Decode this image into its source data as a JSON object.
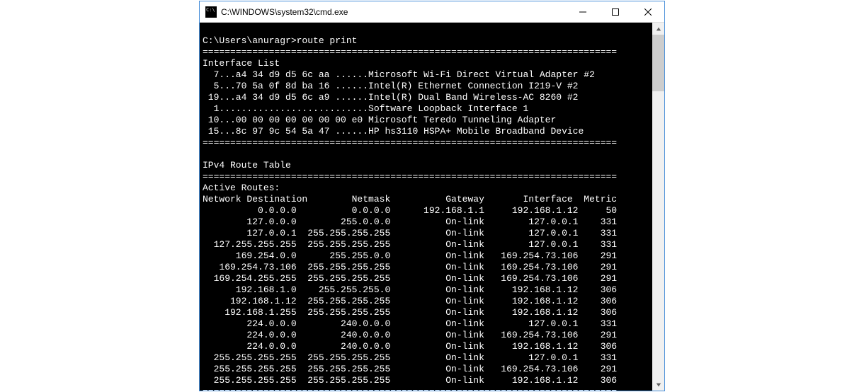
{
  "window": {
    "title": "C:\\WINDOWS\\system32\\cmd.exe"
  },
  "terminal": {
    "prompt": "C:\\Users\\anuragr>",
    "command": "route print",
    "divider": "===========================================================================",
    "interface_list_header": "Interface List",
    "interfaces": [
      "  7...a4 34 d9 d5 6c aa ......Microsoft Wi-Fi Direct Virtual Adapter #2",
      "  5...70 5a 0f 8d ba 16 ......Intel(R) Ethernet Connection I219-V #2",
      " 19...a4 34 d9 d5 6c a9 ......Intel(R) Dual Band Wireless-AC 8260 #2",
      "  1...........................Software Loopback Interface 1",
      " 10...00 00 00 00 00 00 00 e0 Microsoft Teredo Tunneling Adapter",
      " 15...8c 97 9c 54 5a 47 ......HP hs3110 HSPA+ Mobile Broadband Device"
    ],
    "ipv4_header": "IPv4 Route Table",
    "active_routes_header": "Active Routes:",
    "route_columns": {
      "dest": "Network Destination",
      "netmask": "Netmask",
      "gateway": "Gateway",
      "interface": "Interface",
      "metric": "Metric"
    },
    "routes": [
      {
        "dest": "0.0.0.0",
        "netmask": "0.0.0.0",
        "gateway": "192.168.1.1",
        "interface": "192.168.1.12",
        "metric": "50"
      },
      {
        "dest": "127.0.0.0",
        "netmask": "255.0.0.0",
        "gateway": "On-link",
        "interface": "127.0.0.1",
        "metric": "331"
      },
      {
        "dest": "127.0.0.1",
        "netmask": "255.255.255.255",
        "gateway": "On-link",
        "interface": "127.0.0.1",
        "metric": "331"
      },
      {
        "dest": "127.255.255.255",
        "netmask": "255.255.255.255",
        "gateway": "On-link",
        "interface": "127.0.0.1",
        "metric": "331"
      },
      {
        "dest": "169.254.0.0",
        "netmask": "255.255.0.0",
        "gateway": "On-link",
        "interface": "169.254.73.106",
        "metric": "291"
      },
      {
        "dest": "169.254.73.106",
        "netmask": "255.255.255.255",
        "gateway": "On-link",
        "interface": "169.254.73.106",
        "metric": "291"
      },
      {
        "dest": "169.254.255.255",
        "netmask": "255.255.255.255",
        "gateway": "On-link",
        "interface": "169.254.73.106",
        "metric": "291"
      },
      {
        "dest": "192.168.1.0",
        "netmask": "255.255.255.0",
        "gateway": "On-link",
        "interface": "192.168.1.12",
        "metric": "306"
      },
      {
        "dest": "192.168.1.12",
        "netmask": "255.255.255.255",
        "gateway": "On-link",
        "interface": "192.168.1.12",
        "metric": "306"
      },
      {
        "dest": "192.168.1.255",
        "netmask": "255.255.255.255",
        "gateway": "On-link",
        "interface": "192.168.1.12",
        "metric": "306"
      },
      {
        "dest": "224.0.0.0",
        "netmask": "240.0.0.0",
        "gateway": "On-link",
        "interface": "127.0.0.1",
        "metric": "331"
      },
      {
        "dest": "224.0.0.0",
        "netmask": "240.0.0.0",
        "gateway": "On-link",
        "interface": "169.254.73.106",
        "metric": "291"
      },
      {
        "dest": "224.0.0.0",
        "netmask": "240.0.0.0",
        "gateway": "On-link",
        "interface": "192.168.1.12",
        "metric": "306"
      },
      {
        "dest": "255.255.255.255",
        "netmask": "255.255.255.255",
        "gateway": "On-link",
        "interface": "127.0.0.1",
        "metric": "331"
      },
      {
        "dest": "255.255.255.255",
        "netmask": "255.255.255.255",
        "gateway": "On-link",
        "interface": "169.254.73.106",
        "metric": "291"
      },
      {
        "dest": "255.255.255.255",
        "netmask": "255.255.255.255",
        "gateway": "On-link",
        "interface": "192.168.1.12",
        "metric": "306"
      }
    ]
  }
}
